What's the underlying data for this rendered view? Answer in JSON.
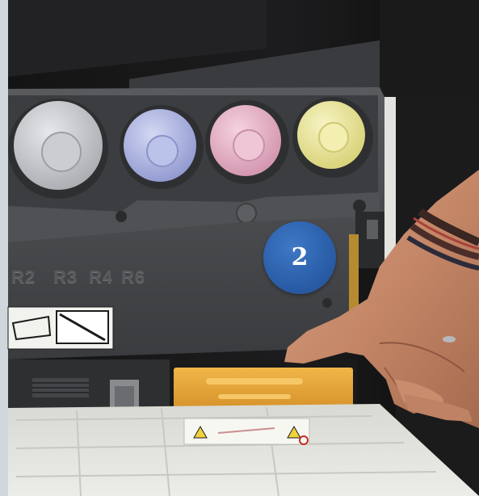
{
  "step": {
    "number": "2"
  },
  "slot_labels": [
    "R2",
    "R3",
    "R4",
    "R6"
  ],
  "toner_colors": {
    "black": "#c9cbcf",
    "cyan": "#b7bfe6",
    "magenta": "#e9b9cc",
    "yellow": "#eee99e"
  },
  "badge_color": "#2a5ea8",
  "waste_cartridge_color": "#e7a63a",
  "icons": [
    "toner-cartridge-icon",
    "waste-toner-box-icon",
    "warning-label-icon",
    "hand-icon"
  ]
}
